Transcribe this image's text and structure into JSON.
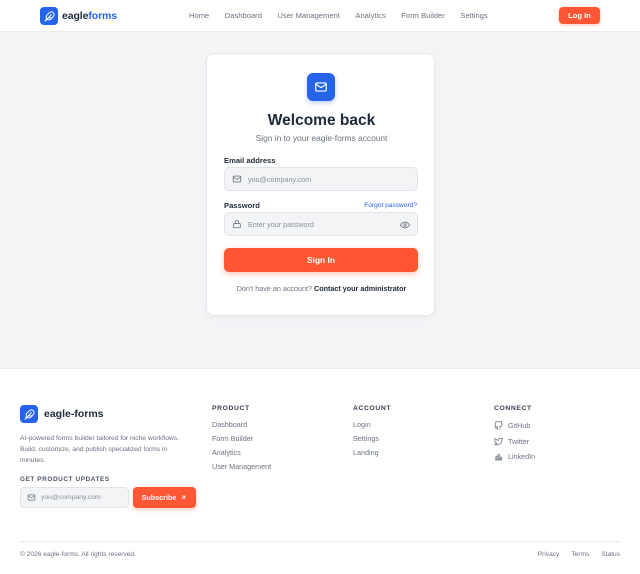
{
  "header": {
    "logo_text_main": "eagle",
    "logo_text_accent": "forms",
    "nav": [
      "Home",
      "Dashboard",
      "User Management",
      "Analytics",
      "Form Builder",
      "Settings"
    ],
    "login_label": "Log In"
  },
  "card": {
    "icon": "mail-icon",
    "title": "Welcome back",
    "subtitle": "Sign in to your eagle-forms account",
    "email_label": "Email address",
    "email_placeholder": "you@company.com",
    "password_label": "Password",
    "forgot_label": "Forgot password?",
    "password_placeholder": "Enter your password",
    "signin_label": "Sign In",
    "no_account_text": "Don't have an account?",
    "contact_label": "Contact your administrator"
  },
  "footer": {
    "brand": "eagle-forms",
    "description": "AI-powered forms builder tailored for niche workflows. Build, customize, and publish specialized forms in minutes.",
    "updates_heading": "GET PRODUCT UPDATES",
    "email_placeholder": "you@company.com",
    "subscribe_label": "Subscribe",
    "columns": [
      {
        "heading": "PRODUCT",
        "links": [
          "Dashboard",
          "Form Builder",
          "Analytics",
          "User Management"
        ]
      },
      {
        "heading": "ACCOUNT",
        "links": [
          "Login",
          "Settings",
          "Landing"
        ]
      },
      {
        "heading": "CONNECT",
        "links": [
          "GitHub",
          "Twitter",
          "LinkedIn"
        ]
      }
    ],
    "copyright": "© 2026 eagle-forms. All rights reserved.",
    "legal": [
      "Privacy",
      "Terms",
      "Status"
    ]
  },
  "colors": {
    "brand_blue": "#2563eb",
    "accent_orange": "#ff5733",
    "background": "#f4f4f7"
  }
}
